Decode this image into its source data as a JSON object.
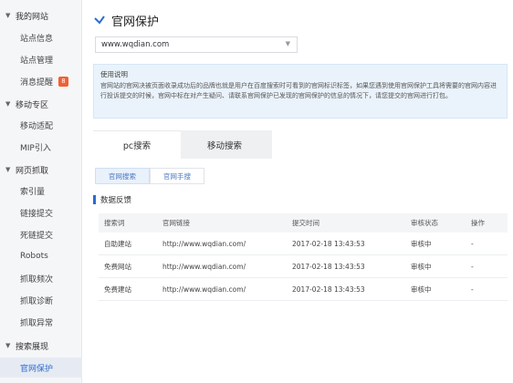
{
  "sidebar": {
    "groups": [
      {
        "title": "我的网站",
        "items": [
          "站点信息",
          "站点管理",
          "消息提醒"
        ]
      },
      {
        "title": "移动专区",
        "items": [
          "移动适配",
          "MIP引入"
        ]
      },
      {
        "title": "网页抓取",
        "items": [
          "索引量",
          "链接提交",
          "死链提交",
          "Robots",
          "抓取频次",
          "抓取诊断",
          "抓取异常"
        ]
      },
      {
        "title": "搜索展现",
        "items": [
          "官网保护"
        ]
      }
    ],
    "message_badge": "8",
    "active_item": "官网保护"
  },
  "page": {
    "title": "官网保护"
  },
  "site_select": {
    "value": "www.wqdian.com"
  },
  "notice": {
    "title": "使用说明",
    "text": "官网站的官网决被页面收录成功后的品牌也就是用户在百度搜索时可看到的官网标识标签，如果您遇到使用官网保护工具将需要的官网内容进行投诉提交的时候，官网中标在对产生疑问、请联系官网保护已发现的官网保护的信息的情况下，请您提交的官网进行打包。"
  },
  "main_tabs": [
    "pc搜索",
    "移动搜索"
  ],
  "sub_tabs": [
    "官网搜索",
    "官网手搜"
  ],
  "section": {
    "title": "数据反馈"
  },
  "table": {
    "headers": [
      "搜索词",
      "官网链接",
      "提交时间",
      "审核状态",
      "操作"
    ],
    "rows": [
      [
        "自助建站",
        "http://www.wqdian.com/",
        "2017-02-18 13:43:53",
        "审核中",
        "-"
      ],
      [
        "免费网站",
        "http://www.wqdian.com/",
        "2017-02-18 13:43:53",
        "审核中",
        "-"
      ],
      [
        "免费建站",
        "http://www.wqdian.com/",
        "2017-02-18 13:43:53",
        "审核中",
        "-"
      ]
    ]
  },
  "colors": {
    "accent": "#2b6ccd",
    "badge": "#f25f32",
    "notice_bg": "#eaf3fb"
  },
  "icons": {
    "group_toggle": "chevron-down-icon",
    "title_logo": "checkmark-logo-icon",
    "select_arrow": "chevron-down-icon"
  }
}
